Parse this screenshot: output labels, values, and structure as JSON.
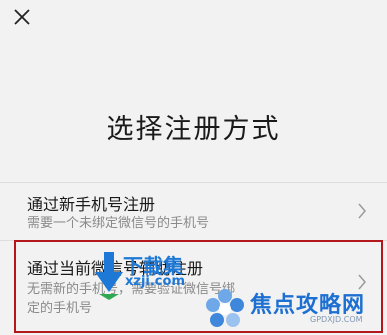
{
  "header": {
    "close_icon": "close-icon"
  },
  "page": {
    "title": "选择注册方式"
  },
  "options": [
    {
      "title": "通过新手机号注册",
      "description": "需要一个未绑定微信号的手机号",
      "chevron_icon": "chevron-right-icon"
    },
    {
      "title": "通过当前微信号辅助注册",
      "description": "无需新的手机号，需要验证微信号绑定的手机号",
      "chevron_icon": "chevron-right-icon"
    }
  ],
  "watermarks": {
    "top": {
      "title": "下载集",
      "subtitle": "xzji.com"
    },
    "bottom": {
      "title": "焦点攻略网",
      "subtitle": "GPDXJD.COM"
    }
  },
  "colors": {
    "background": "#f2f2f2",
    "highlight_border": "#b3161b",
    "watermark_blue": "#1e78d6"
  }
}
